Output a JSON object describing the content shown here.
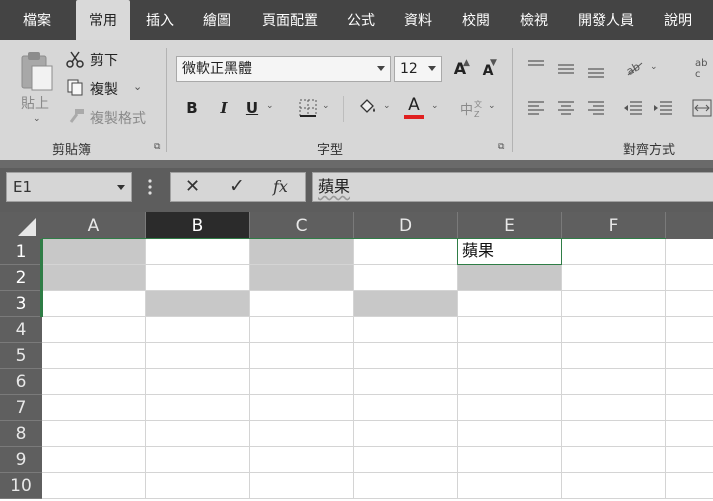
{
  "tabs": [
    {
      "label": "檔案",
      "active": false
    },
    {
      "label": "常用",
      "active": true
    },
    {
      "label": "插入",
      "active": false
    },
    {
      "label": "繪圖",
      "active": false
    },
    {
      "label": "頁面配置",
      "active": false
    },
    {
      "label": "公式",
      "active": false
    },
    {
      "label": "資料",
      "active": false
    },
    {
      "label": "校閱",
      "active": false
    },
    {
      "label": "檢視",
      "active": false
    },
    {
      "label": "開發人員",
      "active": false
    },
    {
      "label": "說明",
      "active": false
    }
  ],
  "clipboard": {
    "paste": "貼上",
    "cut": "剪下",
    "copy": "複製",
    "format_painter": "複製格式",
    "group_label": "剪貼簿"
  },
  "font": {
    "name": "微軟正黑體",
    "size": "12",
    "grow_glyph": "A",
    "shrink_glyph": "A",
    "bold": "B",
    "italic": "I",
    "underline": "U",
    "font_color_glyph": "A",
    "font_color": "#e02020",
    "phonetic_glyph": "中",
    "group_label": "字型"
  },
  "alignment": {
    "group_label": "對齊方式"
  },
  "formula_bar": {
    "name_box": "E1",
    "cancel": "✕",
    "enter": "✓",
    "fx": "fx",
    "content": "蘋果"
  },
  "columns": [
    "A",
    "B",
    "C",
    "D",
    "E",
    "F"
  ],
  "selected_column": "B",
  "rows": [
    "1",
    "2",
    "3",
    "4",
    "5",
    "6",
    "7",
    "8",
    "9",
    "10"
  ],
  "cells": {
    "E1": "蘋果"
  },
  "filled_cells": [
    "A1",
    "C1",
    "A2",
    "C2",
    "E2",
    "B3",
    "D3"
  ],
  "colors": {
    "fill_gray": "#c8c8c8",
    "selection_green": "#2f7d46"
  }
}
